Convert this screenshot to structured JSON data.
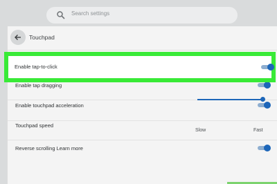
{
  "search": {
    "placeholder": "Search settings"
  },
  "page": {
    "title": "Touchpad"
  },
  "settings": [
    {
      "label": "Enable tap-to-click",
      "enabled": true,
      "highlighted": true
    },
    {
      "label": "Enable tap dragging",
      "enabled": true
    },
    {
      "label": "Enable touchpad acceleration",
      "enabled": true
    },
    {
      "label": "Touchpad speed",
      "slow_label": "Slow",
      "fast_label": "Fast",
      "value_fraction": 1.0
    },
    {
      "label": "Reverse scrolling Learn more",
      "enabled": true
    }
  ],
  "colors": {
    "accent": "#1d66b9",
    "track": "#8eaed0",
    "highlight": "#39ea37"
  }
}
